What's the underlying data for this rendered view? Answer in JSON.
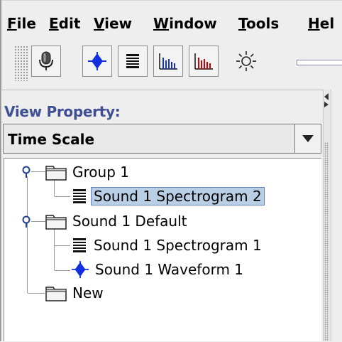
{
  "menu": {
    "items": [
      {
        "mnemonic": "F",
        "rest": "ile"
      },
      {
        "mnemonic": "E",
        "rest": "dit"
      },
      {
        "mnemonic": "V",
        "rest": "iew"
      },
      {
        "mnemonic": "W",
        "rest": "indow"
      },
      {
        "mnemonic": "T",
        "rest": "ools"
      },
      {
        "mnemonic": "H",
        "rest": "el"
      }
    ]
  },
  "toolbar": {
    "icons": [
      "microphone-icon",
      "waveform-icon",
      "spectrogram-icon",
      "bar-chart-blue-icon",
      "bar-chart-red-icon",
      "brightness-icon"
    ]
  },
  "view_property": {
    "label": "View Property:",
    "selected": "Time Scale"
  },
  "tree": {
    "nodes": [
      {
        "label": "Group 1",
        "type": "folder",
        "expanded": true
      },
      {
        "label": "Sound 1 Spectrogram 2",
        "type": "spectrogram",
        "selected": true
      },
      {
        "label": "Sound 1 Default",
        "type": "folder",
        "expanded": true
      },
      {
        "label": "Sound 1 Spectrogram 1",
        "type": "spectrogram"
      },
      {
        "label": "Sound 1 Waveform 1",
        "type": "waveform"
      },
      {
        "label": "New",
        "type": "folder"
      }
    ]
  },
  "colors": {
    "accent_label": "#3f4f93",
    "selection": "#b8cfe5",
    "waveform_blue": "#1030e0",
    "bar_red": "#cc0000"
  }
}
